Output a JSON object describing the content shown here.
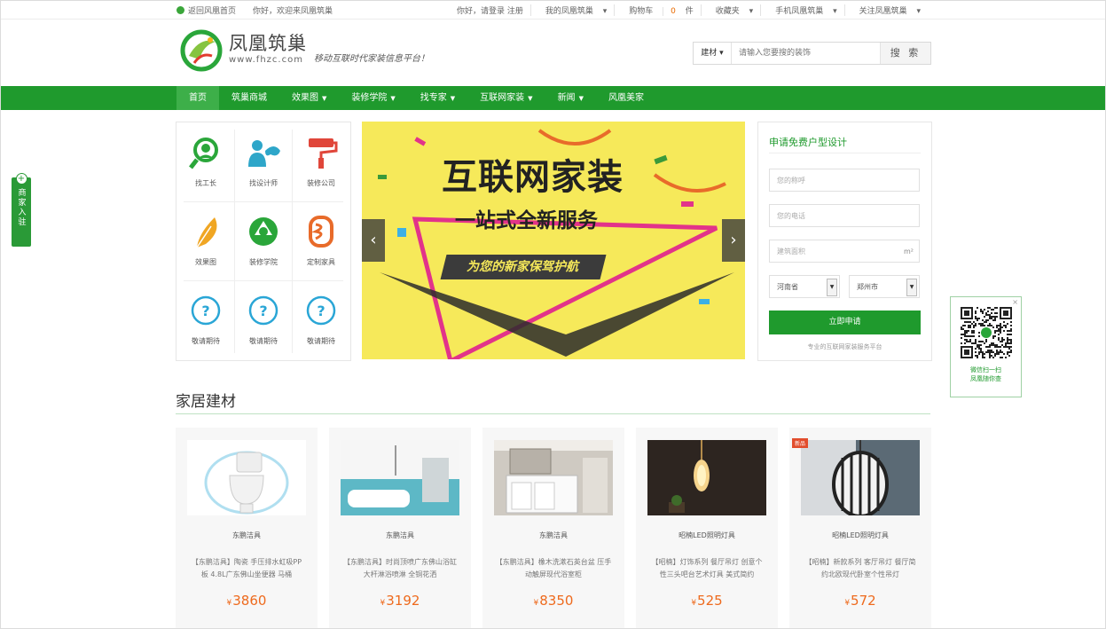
{
  "topbar": {
    "home_link": "返回风凰首页",
    "welcome": "你好，欢迎来凤凰筑巢",
    "links": [
      "你好，请登录 注册",
      "我的凤凰筑巢",
      "购物车",
      "收藏夹",
      "手机凤凰筑巢",
      "关注凤凰筑巢"
    ],
    "cart_count": "0"
  },
  "header": {
    "brand": "凤凰筑巢",
    "url": "www.fhzc.com",
    "slogan": "移动互联时代家装信息平台！",
    "search": {
      "category": "建材",
      "placeholder": "请输入您要搜的装饰",
      "button": "搜 索"
    }
  },
  "nav": {
    "items": [
      {
        "label": "首页",
        "dropdown": false,
        "active": true
      },
      {
        "label": "筑巢商城",
        "dropdown": false,
        "active": false
      },
      {
        "label": "效果图",
        "dropdown": true,
        "active": false
      },
      {
        "label": "装修学院",
        "dropdown": true,
        "active": false
      },
      {
        "label": "找专家",
        "dropdown": true,
        "active": false
      },
      {
        "label": "互联网家装",
        "dropdown": true,
        "active": false
      },
      {
        "label": "新闻",
        "dropdown": true,
        "active": false
      },
      {
        "label": "风凰美家",
        "dropdown": false,
        "active": false
      }
    ]
  },
  "sidetab": {
    "label": "商家入驻",
    "icon": "plus-icon"
  },
  "services": [
    {
      "label": "找工长",
      "icon": "worker-search-icon"
    },
    {
      "label": "找设计师",
      "icon": "designer-icon"
    },
    {
      "label": "装修公司",
      "icon": "paint-roller-icon"
    },
    {
      "label": "效果图",
      "icon": "feather-icon"
    },
    {
      "label": "装修学院",
      "icon": "shutter-icon"
    },
    {
      "label": "定制家具",
      "icon": "furniture-icon"
    },
    {
      "label": "敬请期待",
      "icon": "question-icon"
    },
    {
      "label": "敬请期待",
      "icon": "question-icon"
    },
    {
      "label": "敬请期待",
      "icon": "question-icon"
    }
  ],
  "banner": {
    "headline": "互联网家装",
    "subline": "一站式全新服务",
    "tagline": "为您的新家保驾护航",
    "prev": "‹",
    "next": "›"
  },
  "form": {
    "title": "申请免费户型设计",
    "name_placeholder": "您的称呼",
    "phone_placeholder": "您的电话",
    "area_placeholder": "建筑面积",
    "area_unit": "m²",
    "province": "河南省",
    "city": "郑州市",
    "submit": "立即申请",
    "note": "专业的互联网家装服务平台"
  },
  "qr": {
    "caption_line1": "微信扫一扫",
    "caption_line2": "凤凰随你查",
    "close": "×"
  },
  "section": {
    "title": "家居建材"
  },
  "products": [
    {
      "brand": "东鹏洁具",
      "desc": "【东鹏洁具】陶瓷 手压排水虹吸PP板 4.8L广东佛山坐便器 马桶",
      "price": "3860",
      "currency": "¥",
      "tag": ""
    },
    {
      "brand": "东鹏洁具",
      "desc": "【东鹏洁具】时尚顶喷广东佛山浴缸 大杆淋浴喷淋 全铜花洒",
      "price": "3192",
      "currency": "¥",
      "tag": ""
    },
    {
      "brand": "东鹏洁具",
      "desc": "【东鹏洁具】橡木洗漱石英台盆 压手动触屏现代浴室柜",
      "price": "8350",
      "currency": "¥",
      "tag": ""
    },
    {
      "brand": "昭楠LED照明灯具",
      "desc": "【昭楠】灯饰系列 餐厅吊灯 创意个性三头吧台艺术灯具 美式简约",
      "price": "525",
      "currency": "¥",
      "tag": ""
    },
    {
      "brand": "昭楠LED照明灯具",
      "desc": "【昭楠】新款系列 客厅吊灯 餐厅简约北欧现代卧室个性吊灯",
      "price": "572",
      "currency": "¥",
      "tag": "新品"
    }
  ]
}
